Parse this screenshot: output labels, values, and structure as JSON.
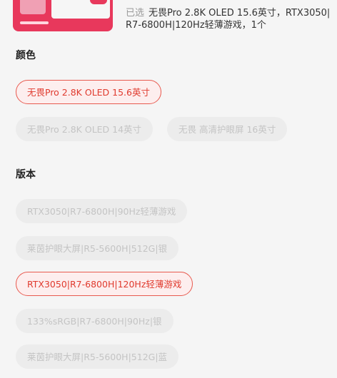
{
  "selection": {
    "prefix": "已选",
    "text": "无畏Pro 2.8K OLED 15.6英寸，RTX3050|R7-6800H|120Hz轻薄游戏，1个"
  },
  "sections": {
    "color": {
      "title": "颜色",
      "options": [
        {
          "label": "无畏Pro 2.8K OLED 15.6英寸",
          "state": "selected"
        },
        {
          "label": "无畏Pro 2.8K OLED 14英寸",
          "state": "disabled"
        },
        {
          "label": "无畏 高清护眼屏 16英寸",
          "state": "disabled"
        }
      ]
    },
    "version": {
      "title": "版本",
      "options": [
        {
          "label": "RTX3050|R7-6800H|90Hz轻薄游戏",
          "state": "disabled"
        },
        {
          "label": "莱茵护眼大屏|R5-5600H|512G|银",
          "state": "disabled"
        },
        {
          "label": "RTX3050|R7-6800H|120Hz轻薄游戏",
          "state": "selected"
        },
        {
          "label": "133%sRGB|R7-6800H|90Hz|银",
          "state": "disabled"
        },
        {
          "label": "莱茵护眼大屏|R5-5600H|512G|蓝",
          "state": "disabled"
        }
      ]
    }
  },
  "colors": {
    "accent": "#e03a2e",
    "accent_border": "#e85a4f",
    "selected_bg": "#fdeeee",
    "disabled_bg": "#ececec",
    "disabled_text": "#c4c4c4"
  }
}
